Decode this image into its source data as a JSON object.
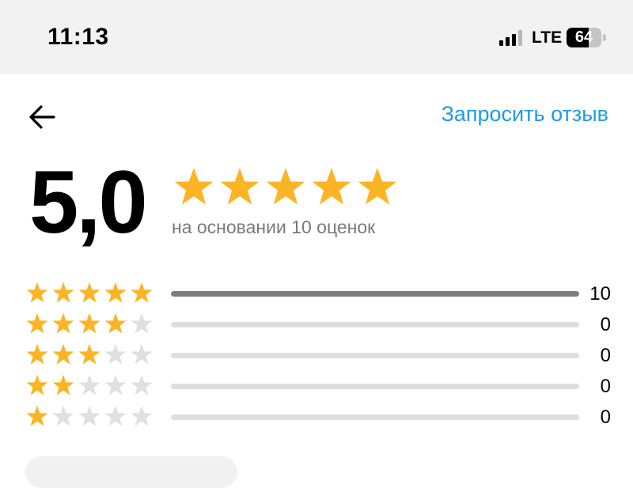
{
  "status_bar": {
    "time": "11:13",
    "network": "LTE",
    "battery_level": "64",
    "battery_fraction": 0.64,
    "signal_icon": "cellular-signal-icon",
    "battery_icon": "battery-icon"
  },
  "header": {
    "back_icon": "arrow-left-icon",
    "request_review_label": "Запросить отзыв"
  },
  "summary": {
    "rating_value": "5,0",
    "stars_filled": 5,
    "stars_total": 5,
    "based_on_text": "на основании 10 оценок"
  },
  "breakdown": [
    {
      "stars": 5,
      "count": "10",
      "fraction": 1.0
    },
    {
      "stars": 4,
      "count": "0",
      "fraction": 0.0
    },
    {
      "stars": 3,
      "count": "0",
      "fraction": 0.0
    },
    {
      "stars": 2,
      "count": "0",
      "fraction": 0.0
    },
    {
      "stars": 1,
      "count": "0",
      "fraction": 0.0
    }
  ],
  "colors": {
    "accent": "#1e9be6",
    "star_filled": "#fbb524",
    "star_empty": "#e0e0e0",
    "bar_fill": "#7d7d7d",
    "bar_track": "#dedede",
    "secondary_text": "#7a7a7a",
    "status_bar_bg": "#f2f2f2"
  }
}
